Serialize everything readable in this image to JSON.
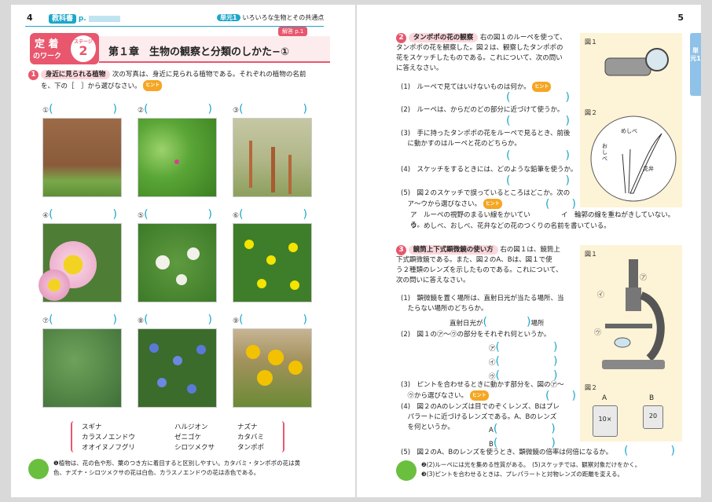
{
  "left": {
    "page_number": "4",
    "header": {
      "book_label": "教科書",
      "page_prefix": "p.",
      "unit_chip": "単元1",
      "unit_title": "いろいろな生物とその共通点"
    },
    "badge": {
      "line1": "定 着",
      "line2": "のワーク",
      "stage_label": "ステージ",
      "stage_num": "2"
    },
    "chapter_title": "第１章　生物の観察と分類のしかた−①",
    "answer_ref": "解答 p.1",
    "q1": {
      "num": "1",
      "label": "身近に見られる植物",
      "text1": "次の写真は、身近に見られる植物である。それぞれの植物の名前",
      "text2": "を、下の［　］から選びなさい。",
      "hint": "ヒント"
    },
    "photo_labels": [
      "①",
      "②",
      "③",
      "④",
      "⑤",
      "⑥",
      "⑦",
      "⑧",
      "⑨"
    ],
    "choices": [
      [
        "スギナ",
        "ハルジオン",
        "ナズナ"
      ],
      [
        "カラスノエンドウ",
        "ゼニゴケ",
        "カタバミ"
      ],
      [
        "オオイヌノフグリ",
        "シロツメクサ",
        "タンポポ"
      ]
    ],
    "footer_note1": "❶植物は、花の色や形、葉のつき方に着目すると区別しやすい。カタバミ・タンポポの花は黄",
    "footer_note2": "色、ナズナ・シロツメクサの花は白色、カラスノエンドウの花は赤色である。"
  },
  "right": {
    "page_number": "5",
    "side_tab": "単元1",
    "q2": {
      "num": "2",
      "label": "タンポポの花の観察",
      "lines": [
        "右の図１のルーペを使って、",
        "タンポポの花を観察した。図２は、観察したタンポポの",
        "花をスケッチしたものである。これについて、次の問い",
        "に答えなさい。"
      ],
      "sub": [
        "(1)　ルーペで見てはいけないものは何か。",
        "(2)　ルーペは、からだのどの部分に近づけて使うか。",
        "(3)　手に持ったタンポポの花をルーペで見るとき、前後",
        "　に動かすのはルーペと花のどちらか。",
        "(4)　スケッチをするときには、どのような鉛筆を使うか。",
        "(5)　図２のスケッチで誤っているところはどこか。次の",
        "　ア〜ウから選びなさい。"
      ],
      "options": [
        "ア　ルーペの視野のまるい線をかいている。",
        "イ　輪郭の線を重ねがきしていない。",
        "ウ　めしべ、おしべ、花弁などの花のつくりの名前を書いている。"
      ],
      "fig1": "図１",
      "fig2": "図２",
      "fig_labels": {
        "pistil": "めしべ",
        "stamen": "おしべ",
        "petal": "花弁"
      }
    },
    "q3": {
      "num": "3",
      "label": "鏡筒上下式顕微鏡の使い方",
      "lines": [
        "右の図１は、鏡筒上",
        "下式顕微鏡である。また、図２のA、Bは、図１で使",
        "う２種類のレンズを示したものである。これについて、",
        "次の問いに答えなさい。"
      ],
      "sub": [
        "(1)　顕微鏡を置く場所は、直射日光が当たる場所、当",
        "　たらない場所のどちらか。",
        "直射日光が",
        "場所",
        "(2)　図１の㋐〜㋒の部分をそれぞれ何というか。",
        "(3)　ピントを合わせるときに動かす部分を、図の㋐〜",
        "　㋒から選びなさい。",
        "(4)　図２のAのレンズは目でのぞくレンズ、Bはプレ",
        "　パラートに近づけるレンズである。A、Bのレンズ",
        "　を何というか。",
        "(5)　図２のA、Bのレンズを使うとき、顕微鏡の倍率は何倍になるか。"
      ],
      "parts": [
        "㋐",
        "㋑",
        "㋒"
      ],
      "lens_labels": [
        "A",
        "B"
      ],
      "lens_text": [
        "10×",
        "20"
      ],
      "fig1": "図１",
      "fig2": "図２"
    },
    "footer_note1": "❷(2)ルーペには光を集める性質がある。　(5)スケッチでは、観察対象だけをかく。",
    "footer_note2": "❸(3)ピントを合わせるときは、プレパラートと対物レンズの距離を変える。"
  }
}
